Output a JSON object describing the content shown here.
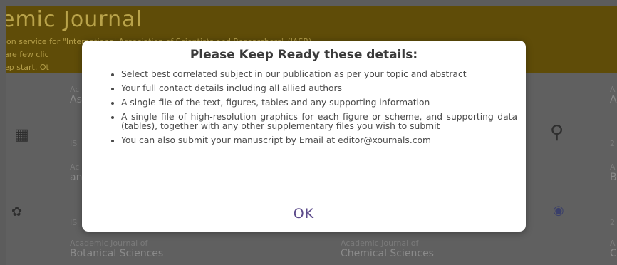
{
  "background": {
    "title": "emic Journal",
    "lines": [
      "ion service for \"International Association of Scientists and Researchers\" (IASR).",
      "are few clic",
      "ep start. Ot"
    ],
    "cards": [
      {
        "small": "Ac",
        "big": "As"
      },
      {
        "small": "IS",
        "big": ""
      },
      {
        "small": "Ac",
        "big": "an"
      },
      {
        "small": "IS",
        "big": ""
      },
      {
        "small": "Academic Journal of",
        "big": "Botanical Sciences"
      },
      {
        "small": "Academic Journal of",
        "big": "Chemical Sciences"
      },
      {
        "small": "A",
        "big": "A"
      },
      {
        "small": "2",
        "big": ""
      },
      {
        "small": "A",
        "big": "B"
      },
      {
        "small": "2",
        "big": ""
      },
      {
        "small": "A",
        "big": "C"
      }
    ]
  },
  "modal": {
    "title": "Please Keep Ready these details:",
    "items": [
      "Select best correlated subject in our publication as per your topic and abstract",
      "Your full contact details including all allied authors",
      "A single file of the text, figures, tables and any supporting information",
      "A single file of high-resolution graphics for each figure or scheme, and supporting data (tables), together with any other supplementary files you wish to submit",
      "You can also submit your manuscript by Email at editor@xournals.com"
    ],
    "ok_label": "OK"
  },
  "colors": {
    "overlay": "#5c5c5c",
    "header_dimmed": "#5f4c08",
    "modal_bg": "#ffffff",
    "ok_text": "#5b4a8a"
  },
  "icons": [
    "calculator-icon",
    "dna-figure-icon",
    "plant-icon",
    "flask-icon"
  ]
}
